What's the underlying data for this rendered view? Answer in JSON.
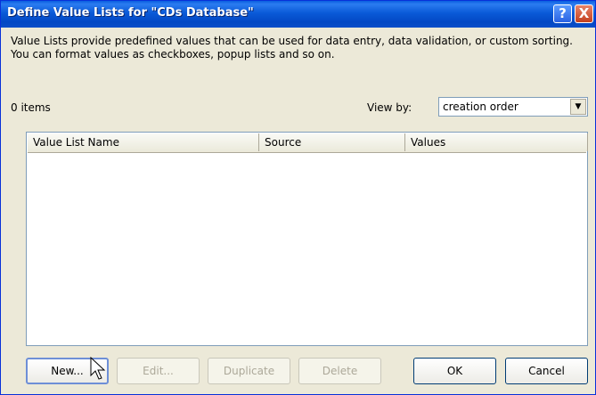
{
  "window": {
    "title": "Define Value Lists for \"CDs Database\"",
    "help_label": "?",
    "close_label": "X"
  },
  "description": "Value Lists provide predefined values that can be used for data entry, data validation, or custom sorting. You can format values as checkboxes, popup lists and so on.",
  "item_count": "0 items",
  "view_by": {
    "label": "View by:",
    "selected": "creation order"
  },
  "table": {
    "columns": [
      "Value List Name",
      "Source",
      "Values"
    ],
    "rows": []
  },
  "buttons": {
    "new": "New...",
    "edit": "Edit...",
    "duplicate": "Duplicate",
    "delete": "Delete",
    "ok": "OK",
    "cancel": "Cancel"
  }
}
